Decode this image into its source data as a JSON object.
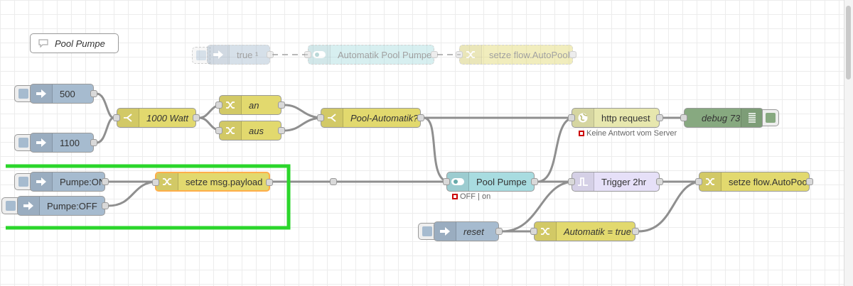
{
  "comment": {
    "label": "Pool Pumpe"
  },
  "nodes": {
    "true_inject": {
      "label": "true ¹"
    },
    "automatik_switch": {
      "label": "Automatik Pool Pumpe"
    },
    "setze_flow_top": {
      "label": "setze flow.AutoPool"
    },
    "inject_500": {
      "label": "500"
    },
    "inject_1100": {
      "label": "1100"
    },
    "switch_1000": {
      "label": "1000 Watt"
    },
    "change_an": {
      "label": "an"
    },
    "change_aus": {
      "label": "aus"
    },
    "switch_pool_auto": {
      "label": "Pool-Automatik?"
    },
    "http_request": {
      "label": "http request",
      "status": "Keine Antwort vom Server"
    },
    "debug": {
      "label": "debug 73"
    },
    "inject_on": {
      "label": "Pumpe:ON"
    },
    "inject_off": {
      "label": "Pumpe:OFF"
    },
    "setze_payload": {
      "label": "setze msg.payload"
    },
    "pool_pumpe": {
      "label": "Pool Pumpe",
      "status": "OFF | on"
    },
    "trigger": {
      "label": "Trigger 2hr"
    },
    "setze_flow": {
      "label": "setze flow.AutoPool"
    },
    "reset": {
      "label": "reset"
    },
    "automatik_true": {
      "label": "Automatik = true"
    }
  },
  "colors": {
    "inject": "#a6bbcf",
    "change": "#e2d96e",
    "switch": "#e2d96e",
    "http": "#e7e7ae",
    "debug": "#87a980",
    "pool": "#a8dce0",
    "trigger": "#e6e0f8",
    "highlight": "#ffae4a",
    "annotation": "#2bd62b",
    "status_error": "#cc0000"
  },
  "icons": {
    "inject": "arrow-in-icon",
    "change": "shuffle-icon",
    "switch": "switch-icon",
    "http": "globe-icon",
    "debug": "list-icon",
    "pool": "toggle-icon",
    "trigger": "pulse-icon",
    "comment": "speech-bubble-icon"
  }
}
